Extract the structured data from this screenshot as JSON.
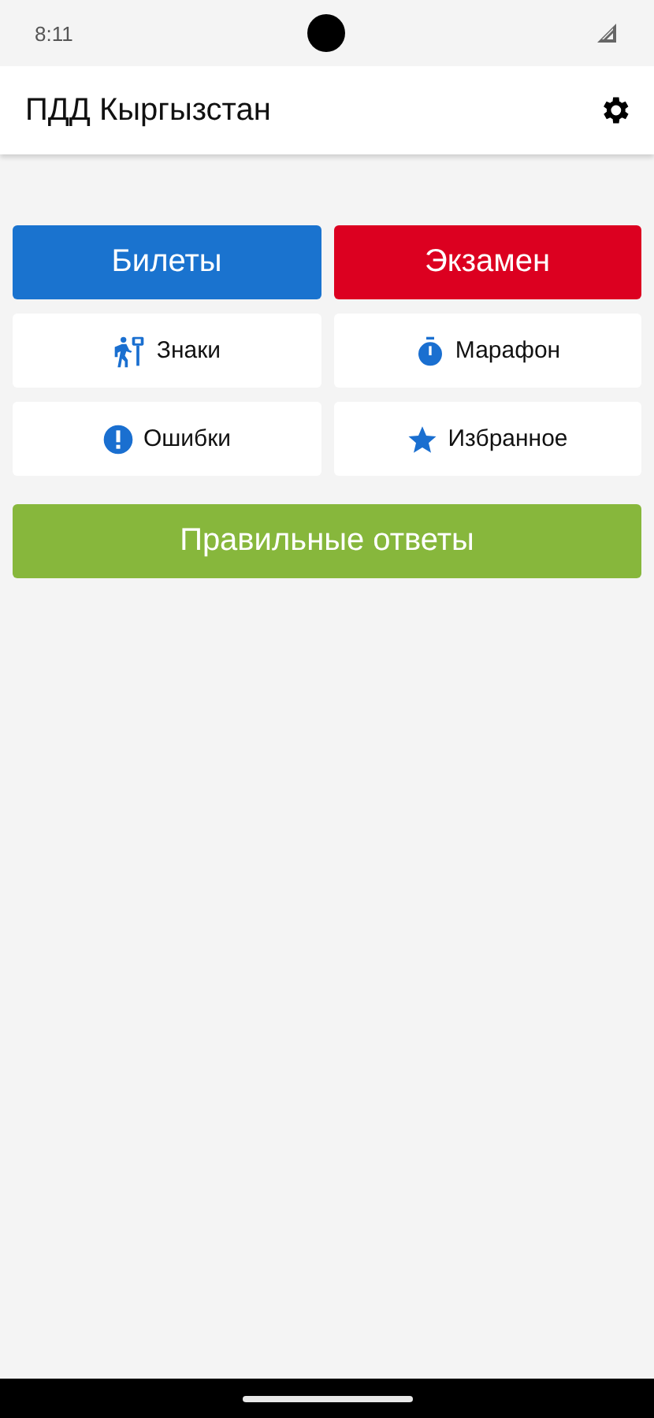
{
  "status_bar": {
    "time": "8:11"
  },
  "app_bar": {
    "title": "ПДД Кыргызстан"
  },
  "main_buttons": [
    {
      "label": "Билеты",
      "color": "#1a73cf"
    },
    {
      "label": "Экзамен",
      "color": "#dc0020"
    }
  ],
  "menu": [
    {
      "label": "Знаки"
    },
    {
      "label": "Марафон"
    },
    {
      "label": "Ошибки"
    },
    {
      "label": "Избранное"
    }
  ],
  "answers_button": {
    "label": "Правильные ответы",
    "color": "#87b73c"
  }
}
